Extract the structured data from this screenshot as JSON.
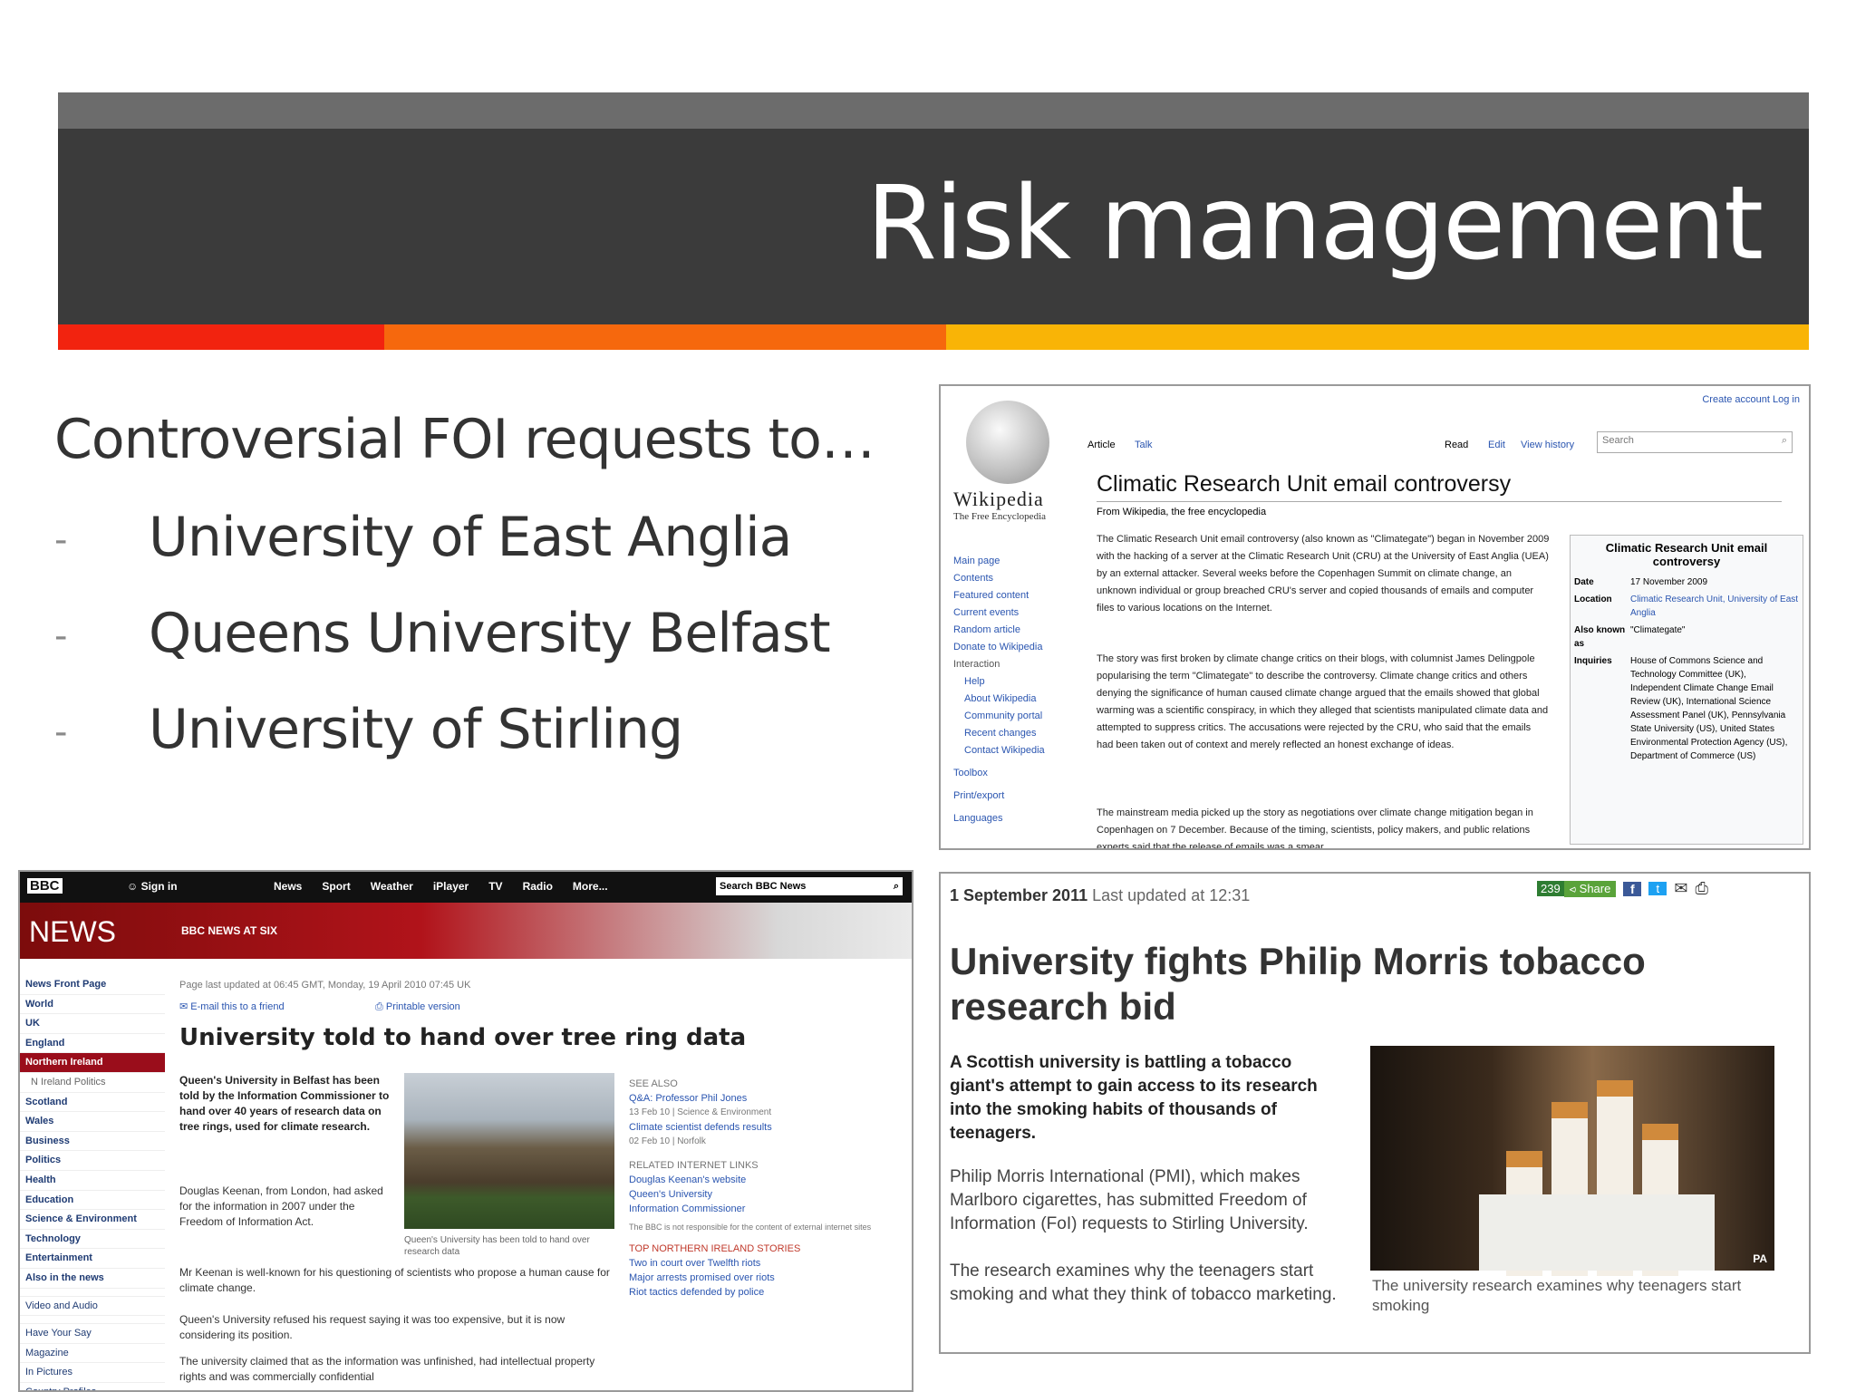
{
  "slide": {
    "title": "Risk management",
    "intro": "Controversial FOI requests to…",
    "bullets": [
      "University of East Anglia",
      "Queens University Belfast",
      "University of Stirling"
    ],
    "bullet_marker": "-"
  },
  "colors": {
    "banner": "#3b3b3b",
    "stripe": "#6c6c6c",
    "accent_red": "#f2230f",
    "accent_orange": "#f6680d",
    "accent_yellow": "#f9b406"
  },
  "wikipedia": {
    "top_links": "Create account  Log in",
    "logo_word": "Wikipedia",
    "logo_tagline": "The Free Encyclopedia",
    "tabs": [
      "Article",
      "Talk"
    ],
    "actions": [
      "Read",
      "Edit",
      "View history"
    ],
    "search_placeholder": "Search",
    "nav": [
      "Main page",
      "Contents",
      "Featured content",
      "Current events",
      "Random article",
      "Donate to Wikipedia"
    ],
    "nav_interaction": "Interaction",
    "nav_interaction_items": [
      "Help",
      "About Wikipedia",
      "Community portal",
      "Recent changes",
      "Contact Wikipedia"
    ],
    "nav_more": [
      "Toolbox",
      "Print/export",
      "Languages"
    ],
    "heading": "Climatic Research Unit email controversy",
    "from": "From Wikipedia, the free encyclopedia",
    "para1": "The Climatic Research Unit email controversy (also known as \"Climategate\") began in November 2009 with the hacking of a server at the Climatic Research Unit (CRU) at the University of East Anglia (UEA) by an external attacker. Several weeks before the Copenhagen Summit on climate change, an unknown individual or group breached CRU's server and copied thousands of emails and computer files to various locations on the Internet.",
    "para2": "The story was first broken by climate change critics on their blogs, with columnist James Delingpole popularising the term \"Climategate\" to describe the controversy. Climate change critics and others denying the significance of human caused climate change argued that the emails showed that global warming was a scientific conspiracy, in which they alleged that scientists manipulated climate data and attempted to suppress critics. The accusations were rejected by the CRU, who said that the emails had been taken out of context and merely reflected an honest exchange of ideas.",
    "para3": "The mainstream media picked up the story as negotiations over climate change mitigation began in Copenhagen on 7 December. Because of the timing, scientists, policy makers, and public relations experts said that the release of emails was a smear",
    "infobox_title": "Climatic Research Unit email controversy",
    "infobox": [
      {
        "k": "Date",
        "v": "17 November 2009"
      },
      {
        "k": "Location",
        "v": "Climatic Research Unit, University of East Anglia"
      },
      {
        "k": "Also known as",
        "v": "\"Climategate\""
      },
      {
        "k": "Inquiries",
        "v": "House of Commons Science and Technology Committee (UK), Independent Climate Change Email Review (UK), International Science Assessment Panel (UK), Pennsylvania State University (US), United States Environmental Protection Agency (US), Department of Commerce (US)"
      }
    ]
  },
  "bbc": {
    "logo": "BBC",
    "sign_in": "Sign in",
    "nav": [
      "News",
      "Sport",
      "Weather",
      "iPlayer",
      "TV",
      "Radio",
      "More..."
    ],
    "search_placeholder": "Search BBC News",
    "section": "NEWS",
    "programme": "BBC NEWS AT SIX",
    "side": [
      "News Front Page",
      "World",
      "UK",
      "England",
      "Northern Ireland",
      "N Ireland Politics",
      "Scotland",
      "Wales",
      "Business",
      "Politics",
      "Health",
      "Education",
      "Science & Environment",
      "Technology",
      "Entertainment",
      "Also in the news",
      "",
      "Video and Audio",
      "",
      "Have Your Say",
      "Magazine",
      "In Pictures",
      "Country Profiles"
    ],
    "updated": "Page last updated at 06:45 GMT, Monday, 19 April 2010 07:45 UK",
    "email": "E-mail this to a friend",
    "printable": "Printable version",
    "headline": "University told to hand over tree ring data",
    "lead": "Queen's University in Belfast has been told by the Information Commissioner to hand over 40 years of research data on tree rings, used for climate research.",
    "p1": "Douglas Keenan, from London, had asked for the information in 2007 under the Freedom of Information Act.",
    "caption": "Queen's University has been told to hand over research data",
    "p2": "Mr Keenan is well-known for his questioning of scientists who propose a human cause for climate change.",
    "p3": "Queen's University refused his request saying it was too expensive, but it is now considering its position.",
    "p4": "The university claimed that as the information was unfinished, had intellectual property rights and was commercially confidential",
    "see_also": "SEE ALSO",
    "see_items": [
      {
        "t": "Q&A: Professor Phil Jones",
        "d": "13 Feb 10 |  Science & Environment"
      },
      {
        "t": "Climate scientist defends results",
        "d": "02 Feb 10 |  Norfolk"
      }
    ],
    "related": "RELATED INTERNET LINKS",
    "related_items": [
      "Douglas Keenan's website",
      "Queen's University",
      "Information Commissioner"
    ],
    "disclaimer": "The BBC is not responsible for the content of external internet sites",
    "top_stories": "TOP NORTHERN IRELAND STORIES",
    "top_items": [
      "Two in court over Twelfth riots",
      "Major arrests promised over riots",
      "Riot tactics defended by police"
    ]
  },
  "scotsman": {
    "date": "1 September 2011",
    "updated": "Last updated at 12:31",
    "share_count": "239",
    "share_label": "Share",
    "headline": "University fights Philip Morris tobacco research bid",
    "lead": "A Scottish university is battling a tobacco giant's attempt to gain access to its research into the smoking habits of thousands of teenagers.",
    "p1": "Philip Morris International (PMI), which makes Marlboro cigarettes, has submitted Freedom of Information (FoI) requests to Stirling University.",
    "p2": "The research examines why the teenagers start smoking and what they think of tobacco marketing.",
    "photo_credit": "PA",
    "caption": "The university research examines why teenagers start smoking"
  }
}
